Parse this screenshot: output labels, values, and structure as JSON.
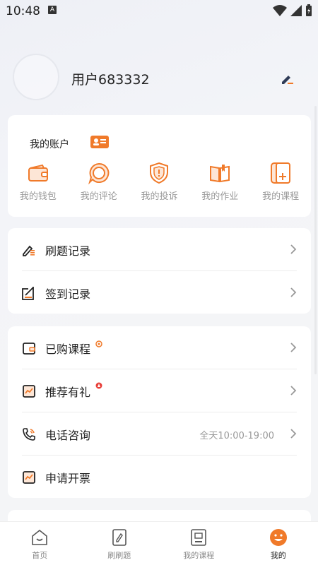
{
  "status": {
    "time": "10:48",
    "a_badge": "A"
  },
  "profile": {
    "username": "用户683332"
  },
  "account": {
    "title": "我的账户",
    "items": [
      {
        "label": "我的钱包",
        "icon": "wallet-icon"
      },
      {
        "label": "我的评论",
        "icon": "comment-icon"
      },
      {
        "label": "我的投诉",
        "icon": "shield-icon"
      },
      {
        "label": "我的作业",
        "icon": "book-icon"
      },
      {
        "label": "我的课程",
        "icon": "course-icon"
      }
    ]
  },
  "list1": [
    {
      "label": "刷题记录",
      "icon": "pen-icon"
    },
    {
      "label": "签到记录",
      "icon": "checkin-icon"
    }
  ],
  "list2": [
    {
      "label": "已购课程",
      "icon": "purchased-icon"
    },
    {
      "label": "推荐有礼",
      "icon": "gift-icon"
    },
    {
      "label": "电话咨询",
      "icon": "phone-icon",
      "value": "全天10:00-19:00"
    },
    {
      "label": "申请开票",
      "icon": "invoice-icon"
    }
  ],
  "tabs": [
    {
      "label": "首页",
      "icon": "home-icon"
    },
    {
      "label": "刷刷题",
      "icon": "practice-icon"
    },
    {
      "label": "我的课程",
      "icon": "my-course-icon"
    },
    {
      "label": "我的",
      "icon": "me-icon",
      "active": true
    }
  ],
  "colors": {
    "accent": "#f07a2a",
    "text": "#222222",
    "muted": "#999999"
  }
}
